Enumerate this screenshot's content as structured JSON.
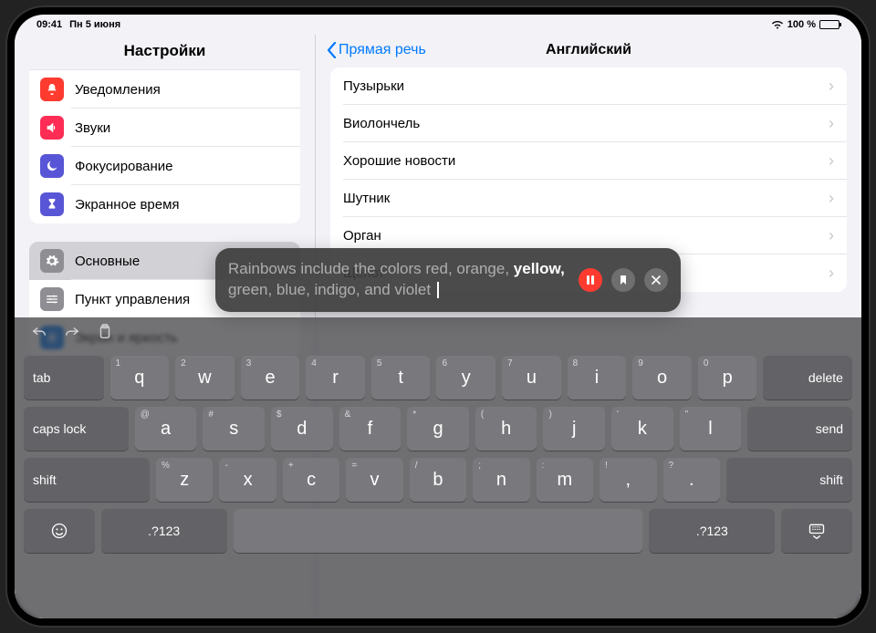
{
  "status": {
    "time": "09:41",
    "date": "Пн 5 июня",
    "battery": "100 %"
  },
  "sidebar": {
    "title": "Настройки",
    "group1": [
      {
        "label": "Уведомления",
        "icon": "bell",
        "color": "#ff3b30"
      },
      {
        "label": "Звуки",
        "icon": "speaker",
        "color": "#ff2d55"
      },
      {
        "label": "Фокусирование",
        "icon": "moon",
        "color": "#5856d6"
      },
      {
        "label": "Экранное время",
        "icon": "hourglass",
        "color": "#5856d6"
      }
    ],
    "group2": [
      {
        "label": "Основные",
        "icon": "gear",
        "color": "#8e8e93",
        "selected": true
      },
      {
        "label": "Пункт управления",
        "icon": "sliders",
        "color": "#8e8e93"
      },
      {
        "label": "Экран и яркость",
        "icon": "brightness",
        "color": "#007aff"
      }
    ]
  },
  "detail": {
    "back": "Прямая речь",
    "title": "Английский",
    "rows": [
      "Пузырьки",
      "Виолончель",
      "Хорошие новости",
      "Шутник",
      "Орган",
      "Щепот"
    ]
  },
  "speech": {
    "before": "Rainbows include the colors red, orange, ",
    "active": "yellow,",
    "after": " green, blue, indigo, and violet "
  },
  "keyboard": {
    "toolbar": [
      "undo",
      "redo",
      "clipboard"
    ],
    "row1_hints": [
      "1",
      "2",
      "3",
      "4",
      "5",
      "6",
      "7",
      "8",
      "9",
      "0"
    ],
    "row1": [
      "q",
      "w",
      "e",
      "r",
      "t",
      "y",
      "u",
      "i",
      "o",
      "p"
    ],
    "row2_hints": [
      "@",
      "#",
      "$",
      "&",
      "*",
      "(",
      ")",
      "'",
      "\""
    ],
    "row2": [
      "a",
      "s",
      "d",
      "f",
      "g",
      "h",
      "j",
      "k",
      "l"
    ],
    "row3_hints": [
      "%",
      "-",
      "+",
      "=",
      "/",
      ";",
      ":",
      "!",
      "?"
    ],
    "row3": [
      "z",
      "x",
      "c",
      "v",
      "b",
      "n",
      "m",
      ",",
      "."
    ],
    "tab": "tab",
    "delete": "delete",
    "caps": "caps lock",
    "send": "send",
    "shift": "shift",
    "num": ".?123"
  }
}
